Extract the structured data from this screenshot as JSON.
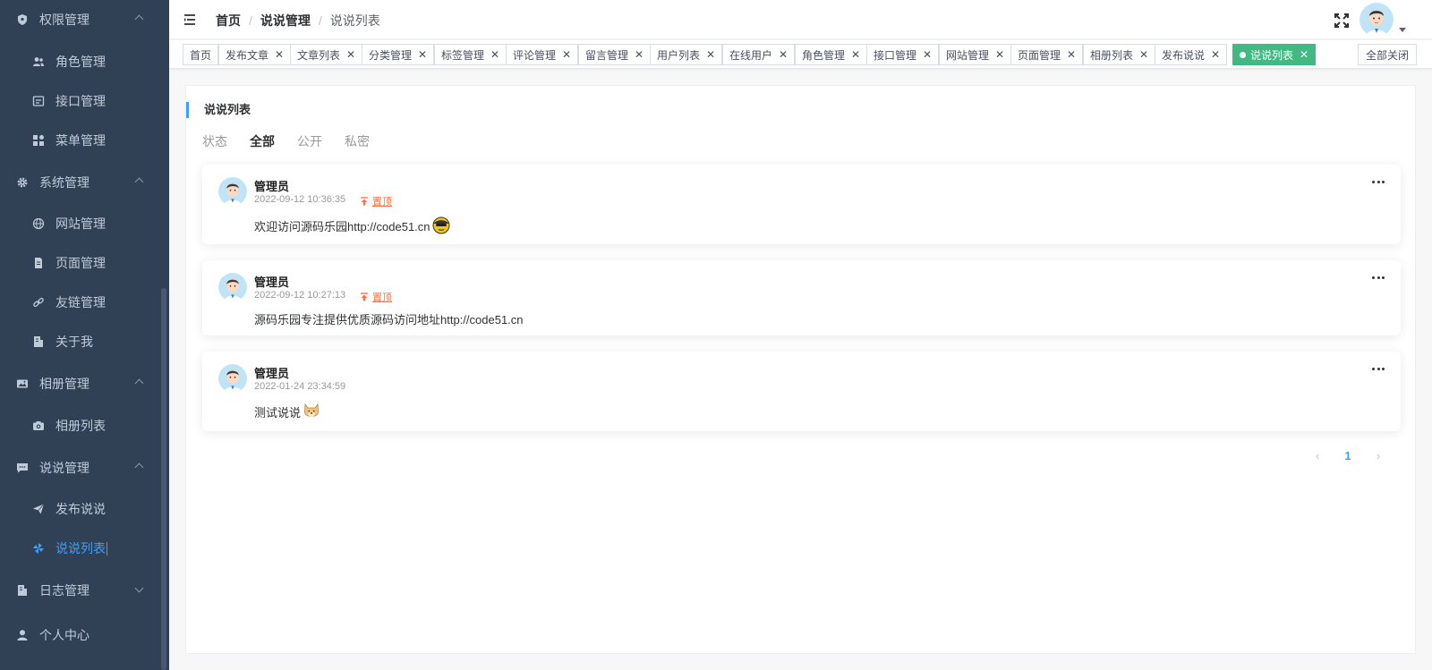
{
  "sidebar": {
    "items": [
      {
        "label": "权限管理",
        "icon": "shield-icon",
        "kind": "group",
        "expanded": true
      },
      {
        "label": "角色管理",
        "icon": "users-icon",
        "kind": "sub"
      },
      {
        "label": "接口管理",
        "icon": "api-icon",
        "kind": "sub"
      },
      {
        "label": "菜单管理",
        "icon": "grid-icon",
        "kind": "sub"
      },
      {
        "label": "系统管理",
        "icon": "gear-icon",
        "kind": "group",
        "expanded": true
      },
      {
        "label": "网站管理",
        "icon": "globe-icon",
        "kind": "sub"
      },
      {
        "label": "页面管理",
        "icon": "page-icon",
        "kind": "sub"
      },
      {
        "label": "友链管理",
        "icon": "link-icon",
        "kind": "sub"
      },
      {
        "label": "关于我",
        "icon": "about-icon",
        "kind": "sub"
      },
      {
        "label": "相册管理",
        "icon": "image-icon",
        "kind": "group",
        "expanded": true
      },
      {
        "label": "相册列表",
        "icon": "camera-icon",
        "kind": "sub"
      },
      {
        "label": "说说管理",
        "icon": "chat-icon",
        "kind": "group",
        "expanded": true
      },
      {
        "label": "发布说说",
        "icon": "send-icon",
        "kind": "sub"
      },
      {
        "label": "说说列表",
        "icon": "pinwheel-icon",
        "kind": "sub",
        "active": true
      },
      {
        "label": "日志管理",
        "icon": "log-icon",
        "kind": "group",
        "expanded": false
      },
      {
        "label": "个人中心",
        "icon": "user-icon",
        "kind": "group"
      }
    ]
  },
  "header": {
    "breadcrumb": [
      "首页",
      "说说管理",
      "说说列表"
    ]
  },
  "tags": {
    "items": [
      {
        "label": "首页",
        "closable": false
      },
      {
        "label": "发布文章",
        "closable": true
      },
      {
        "label": "文章列表",
        "closable": true
      },
      {
        "label": "分类管理",
        "closable": true
      },
      {
        "label": "标签管理",
        "closable": true
      },
      {
        "label": "评论管理",
        "closable": true
      },
      {
        "label": "留言管理",
        "closable": true
      },
      {
        "label": "用户列表",
        "closable": true
      },
      {
        "label": "在线用户",
        "closable": true
      },
      {
        "label": "角色管理",
        "closable": true
      },
      {
        "label": "接口管理",
        "closable": true
      },
      {
        "label": "网站管理",
        "closable": true
      },
      {
        "label": "页面管理",
        "closable": true
      },
      {
        "label": "相册列表",
        "closable": true
      },
      {
        "label": "发布说说",
        "closable": true
      },
      {
        "label": "说说列表",
        "closable": true,
        "active": true
      }
    ],
    "close_all": "全部关闭",
    "close_glyph": "✕"
  },
  "main": {
    "title": "说说列表",
    "status_label": "状态",
    "filters": [
      {
        "label": "全部",
        "active": true
      },
      {
        "label": "公开",
        "active": false
      },
      {
        "label": "私密",
        "active": false
      }
    ],
    "talks": [
      {
        "nickname": "管理员",
        "time": "2022-09-12 10:36:35",
        "top": "置顶",
        "content": "欢迎访问源码乐园http://code51.cn",
        "emoji": "cool-face-emoji"
      },
      {
        "nickname": "管理员",
        "time": "2022-09-12 10:27:13",
        "top": "置顶",
        "content": "源码乐园专注提供优质源码访问地址http://code51.cn",
        "emoji": ""
      },
      {
        "nickname": "管理员",
        "time": "2022-01-24 23:34:59",
        "top": "",
        "content": "测试说说",
        "emoji": "doge-emoji"
      }
    ],
    "pagination": {
      "prev": "‹",
      "current": "1",
      "next": "›"
    }
  },
  "colors": {
    "sidebar_bg": "#304156",
    "sidebar_text": "#bfcbd9",
    "accent": "#409eff",
    "active_tag": "#42b983",
    "top_badge": "#ff7242"
  }
}
